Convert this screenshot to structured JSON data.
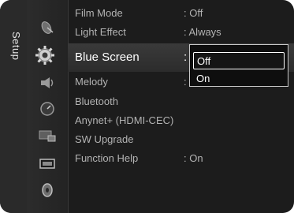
{
  "menu": {
    "section_label": "Setup",
    "items": [
      {
        "label": "Film Mode",
        "value": ": Off"
      },
      {
        "label": "Light Effect",
        "value": ": Always"
      },
      {
        "label": "Blue Screen",
        "value": ":"
      },
      {
        "label": "Melody",
        "value": ":"
      },
      {
        "label": "Bluetooth",
        "value": ""
      },
      {
        "label": "Anynet+ (HDMI-CEC)",
        "value": ""
      },
      {
        "label": "SW Upgrade",
        "value": ""
      },
      {
        "label": "Function Help",
        "value": ": On"
      }
    ],
    "dropdown": {
      "options": [
        "Off",
        "On"
      ],
      "selected": "Off"
    }
  },
  "icons": [
    "satellite-dish-icon",
    "gear-icon",
    "speaker-icon",
    "clock-icon",
    "picture-icon",
    "display-icon",
    "disc-icon"
  ],
  "colors": {
    "background": "#1c1c1c",
    "text": "#b3b3b3",
    "selected_text": "#ffffff",
    "dropdown_border": "#c8c8c8"
  }
}
